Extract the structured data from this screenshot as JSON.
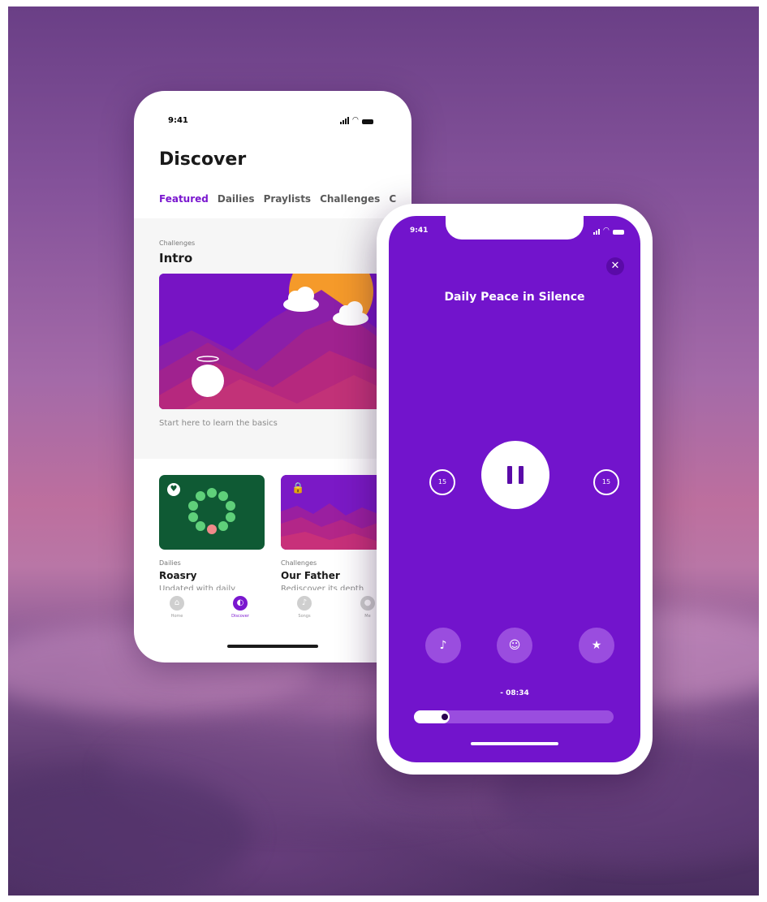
{
  "colors": {
    "accent_purple": "#7a17cf",
    "player_background": "#7214cc",
    "rosary_card_green": "#0f5a34",
    "sun_orange": "#f59a2a"
  },
  "discover_screen": {
    "status_time": "9:41",
    "title": "Discover",
    "tabs": [
      {
        "label": "Featured",
        "active": true
      },
      {
        "label": "Dailies",
        "active": false
      },
      {
        "label": "Praylists",
        "active": false
      },
      {
        "label": "Challenges",
        "active": false
      },
      {
        "label": "C",
        "active": false
      }
    ],
    "featured": {
      "category": "Challenges",
      "title": "Intro",
      "description": "Start here to learn the basics"
    },
    "cards": [
      {
        "category": "Dailies",
        "title": "Roasry",
        "description": "Updated with daily",
        "icon": "heart-badge-icon"
      },
      {
        "category": "Challenges",
        "title": "Our Father",
        "description": "Rediscover its depth",
        "icon": "lock-icon"
      }
    ],
    "nav": [
      {
        "label": "Home",
        "icon": "home-icon",
        "active": false
      },
      {
        "label": "Discover",
        "icon": "discover-icon",
        "active": true
      },
      {
        "label": "Songs",
        "icon": "songs-icon",
        "active": false
      },
      {
        "label": "Me",
        "icon": "profile-icon",
        "active": false
      }
    ]
  },
  "player_screen": {
    "status_time": "9:41",
    "title": "Daily Peace in Silence",
    "rewind_label": "15",
    "forward_label": "15",
    "time_remaining": "- 08:34",
    "progress_fraction": 0.18,
    "actions": [
      {
        "icon": "music-note-icon",
        "glyph": "♪"
      },
      {
        "icon": "guide-icon",
        "glyph": "☺"
      },
      {
        "icon": "star-icon",
        "glyph": "★"
      }
    ]
  }
}
